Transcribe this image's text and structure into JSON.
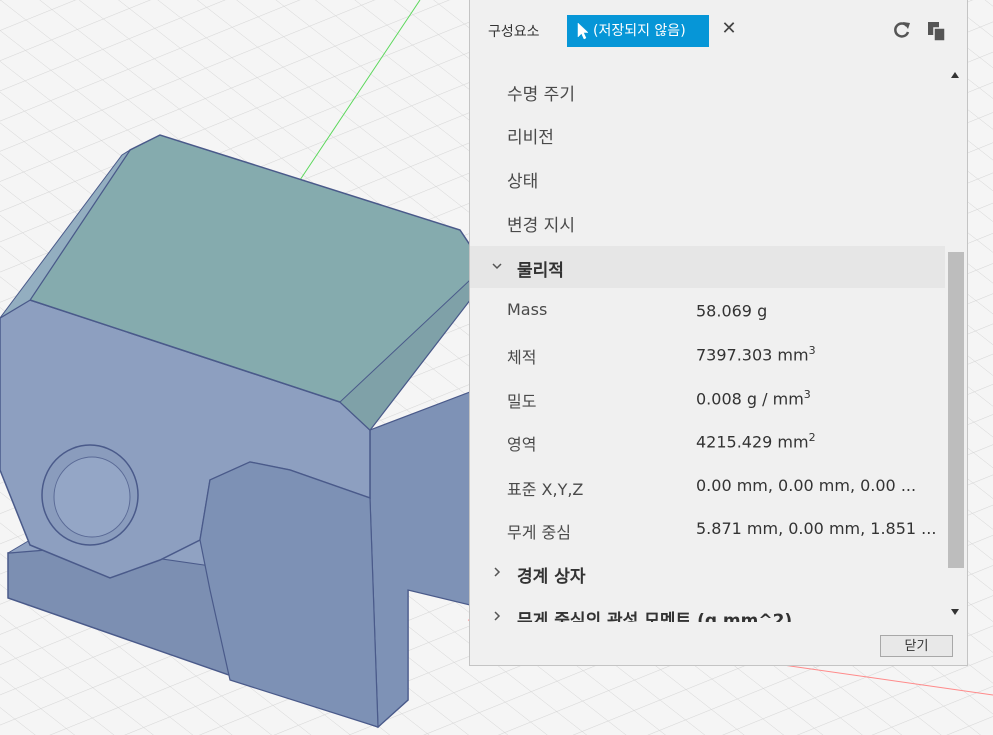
{
  "panel": {
    "tab_label": "구성요소",
    "selection_label": "(저장되지 않음)",
    "close_label": "닫기"
  },
  "collapsed_items": [
    "수명 주기",
    "리비전",
    "상태",
    "변경 지시"
  ],
  "physical": {
    "title": "물리적",
    "rows": [
      {
        "key": "Mass",
        "value": "58.069 g",
        "sup": ""
      },
      {
        "key": "체적",
        "value": "7397.303 mm",
        "sup": "3"
      },
      {
        "key": "밀도",
        "value": "0.008 g / mm",
        "sup": "3"
      },
      {
        "key": "영역",
        "value": "4215.429 mm",
        "sup": "2"
      },
      {
        "key": "표준 X,Y,Z",
        "value": "0.00 mm, 0.00 mm, 0.00 ...",
        "sup": ""
      },
      {
        "key": "무게 중심",
        "value": "5.871 mm, 0.00 mm, 1.851 ...",
        "sup": ""
      }
    ]
  },
  "sections": [
    {
      "title": "경계 상자"
    },
    {
      "title": "무게 중심의 관성 모멘트 (g mm^2)"
    }
  ],
  "colors": {
    "accent": "#0696d7",
    "model_top": "#86acaf",
    "model_side": "#8497b5"
  },
  "icons": {
    "pointer": "cursor-arrow-icon",
    "close": "close-icon",
    "refresh": "refresh-icon",
    "copy": "copy-icon"
  }
}
